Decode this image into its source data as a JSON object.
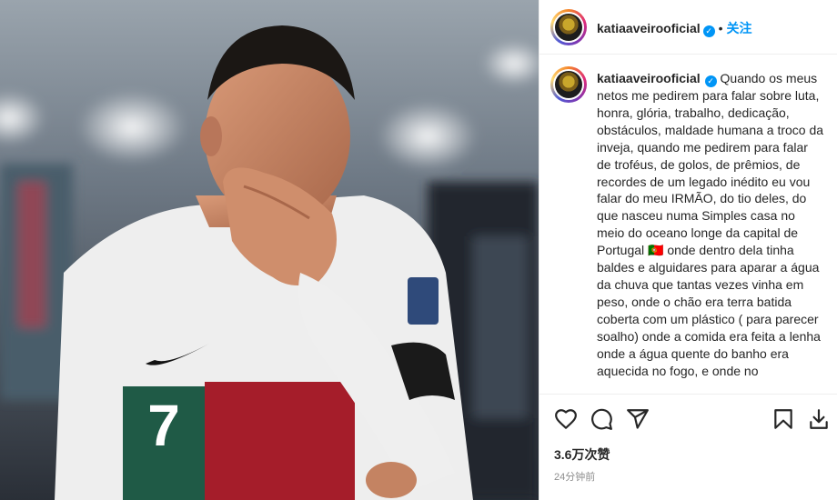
{
  "post": {
    "username": "katiaaveirooficial",
    "follow_label": "关注",
    "separator": "•",
    "verified_mark": "✓",
    "caption": "Quando os meus netos me pedirem para falar sobre luta, honra, glória, trabalho, dedicação, obstáculos, maldade humana a troco da inveja, quando me pedirem para falar de troféus, de golos, de prêmios, de recordes de um legado inédito eu vou falar do meu IRMÃO, do tio deles, do que nasceu numa Simples casa no meio do oceano longe da capital de Portugal 🇵🇹 onde dentro dela tinha baldes e alguidares para aparar a água da chuva que tantas vezes vinha em peso, onde o chão era terra batida coberta com um plástico ( para parecer soalho) onde a comida era feita a lenha onde a água quente do banho era aquecida no fogo, e onde no",
    "likes": "3.6万次赞",
    "time_ago": "24分钟前"
  },
  "photo": {
    "jersey_number": "7"
  },
  "icons": {
    "like": "heart-icon",
    "comment": "comment-icon",
    "share": "send-icon",
    "save": "bookmark-icon",
    "download": "download-icon"
  },
  "colors": {
    "accent": "#0095f6",
    "secondary_text": "#8e8e8e",
    "border": "#efefef"
  }
}
